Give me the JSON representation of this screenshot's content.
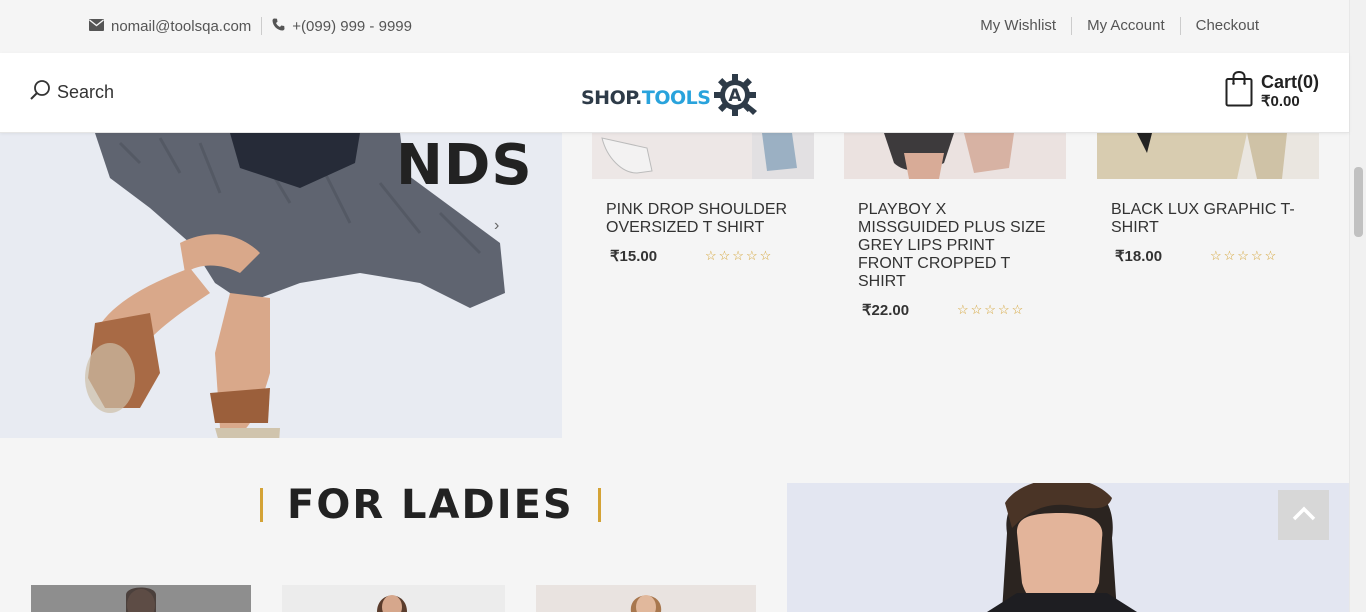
{
  "topbar": {
    "email": "nomail@toolsqa.com",
    "phone": "+(099) 999 - 9999",
    "links": [
      "My Wishlist",
      "My Account",
      "Checkout"
    ]
  },
  "header": {
    "search_label": "Search",
    "logo_shop": "SHOP.",
    "logo_tools": "TOOLS",
    "logo_letter": "A",
    "cart_label": "Cart(0)",
    "cart_total": "₹0.00"
  },
  "hero": {
    "headline_fragment": "NDS"
  },
  "products": [
    {
      "name": "PINK DROP SHOULDER OVERSIZED T SHIRT",
      "price": "₹15.00",
      "rating": 0
    },
    {
      "name": "PLAYBOY X MISSGUIDED PLUS SIZE GREY LIPS PRINT FRONT CROPPED T SHIRT",
      "price": "₹22.00",
      "rating": 0
    },
    {
      "name": "BLACK LUX GRAPHIC T-SHIRT",
      "price": "₹18.00",
      "rating": 0
    }
  ],
  "section": {
    "title": "FOR LADIES"
  },
  "colors": {
    "accent": "#d4a336",
    "logo_dark": "#2e3b48",
    "logo_blue": "#29a3dc"
  },
  "icons": {
    "email": "envelope-icon",
    "phone": "phone-icon",
    "search": "search-icon",
    "cart": "shopping-bag-icon",
    "back_to_top": "chevron-up-icon"
  }
}
